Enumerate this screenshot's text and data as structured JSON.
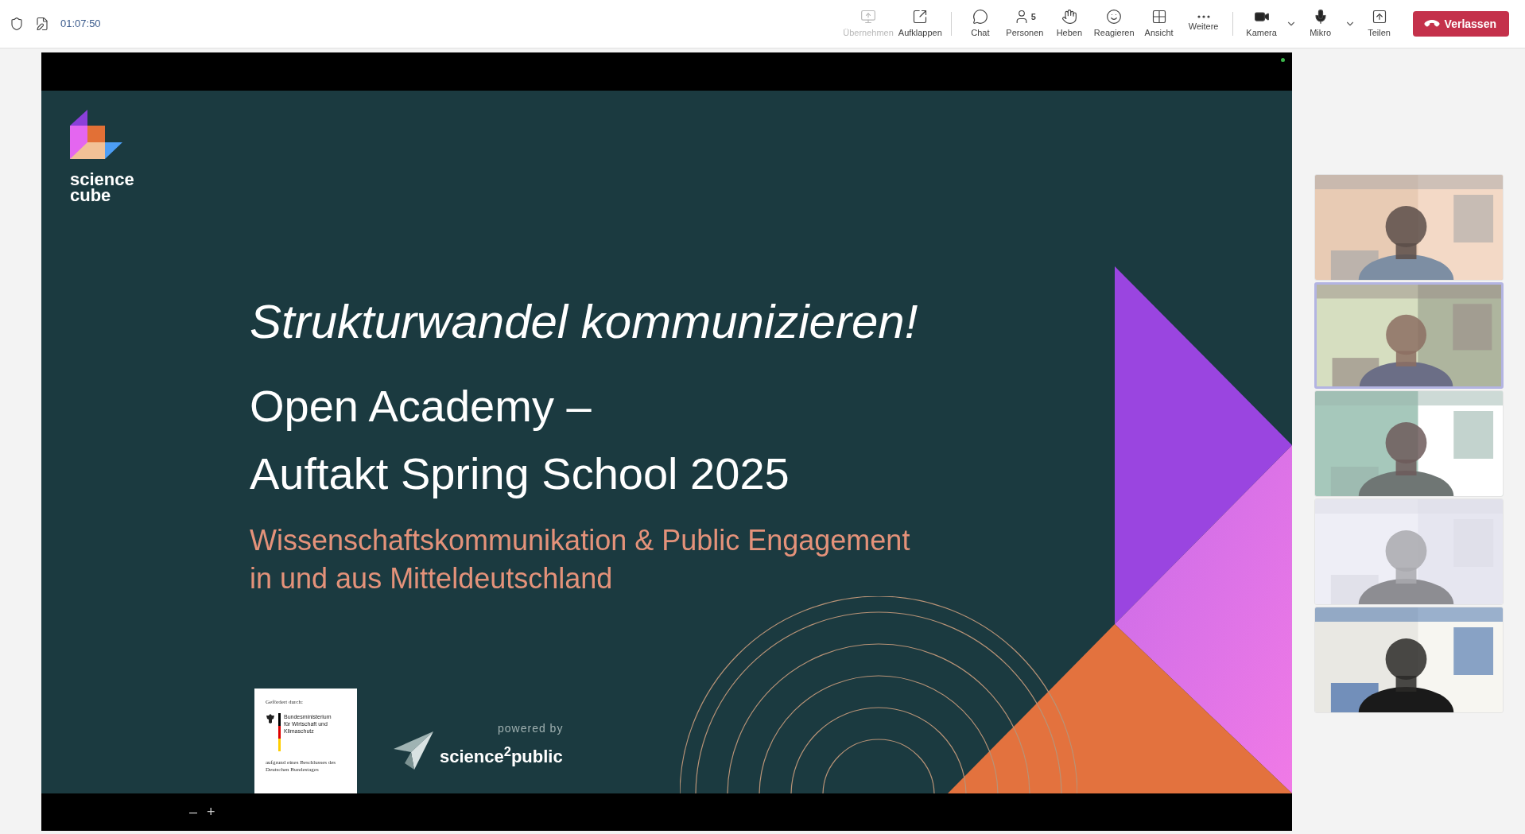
{
  "top_bar": {
    "time": "01:07:50",
    "toolbar": [
      {
        "kind": "button",
        "label": "Übernehmen",
        "disabled": true
      },
      {
        "kind": "button",
        "label": "Aufklappen",
        "disabled": false
      },
      {
        "kind": "divider"
      },
      {
        "kind": "button",
        "label": "Chat",
        "disabled": false
      },
      {
        "kind": "button",
        "label": "Personen",
        "badge": "5",
        "disabled": false
      },
      {
        "kind": "button",
        "label": "Heben",
        "disabled": false
      },
      {
        "kind": "button",
        "label": "Reagieren",
        "disabled": false
      },
      {
        "kind": "button",
        "label": "Ansicht",
        "disabled": false
      },
      {
        "kind": "button",
        "label": "Weitere",
        "disabled": false
      },
      {
        "kind": "divider"
      },
      {
        "kind": "split",
        "label": "Kamera",
        "disabled": false
      },
      {
        "kind": "split",
        "label": "Mikro",
        "disabled": false
      },
      {
        "kind": "button",
        "label": "Teilen",
        "disabled": false
      },
      {
        "kind": "leave",
        "label": "Verlassen",
        "disabled": false
      }
    ]
  },
  "shared_screen": {
    "slide": {
      "logo": "science cube",
      "title": "Strukturwandel kommunizieren!",
      "headline_lines": [
        "Open Academy –",
        "Auftakt Spring School 2025"
      ],
      "subtitle_lines": [
        "Wissenschaftskommunikation & Public Engagement",
        "in und aus Mitteldeutschland"
      ],
      "sponsor": {
        "heading": "Gefördert durch:",
        "ministry": "Bundesministerium für Wirtschaft und Klimaschutz",
        "note": "aufgrund eines Beschlusses des Deutschen Bundestages"
      },
      "powered_by": "powered by",
      "partner": "science$^{2}$public"
    },
    "zoom_controls": [
      "–",
      "+"
    ]
  },
  "participants": [
    {
      "kind": "picture",
      "speaking": false
    },
    {
      "kind": "picture",
      "speaking": true
    },
    {
      "kind": "picture",
      "speaking": false
    },
    {
      "kind": "picture",
      "speaking": false
    },
    {
      "kind": "picture",
      "speaking": false
    }
  ]
}
